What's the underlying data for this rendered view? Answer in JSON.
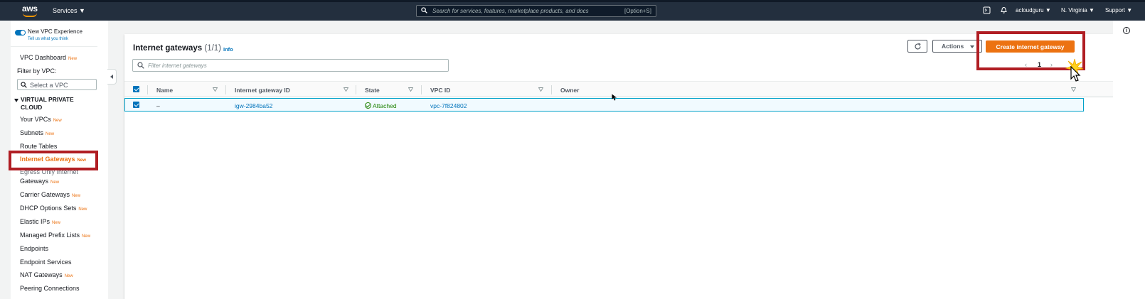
{
  "topnav": {
    "logo": "aws",
    "services_label": "Services",
    "search_placeholder": "Search for services, features, marketplace products, and docs",
    "search_shortcut": "[Option+S]",
    "account": "acloudguru",
    "region": "N. Virginia",
    "support": "Support"
  },
  "sidebar": {
    "new_experience": "New VPC Experience",
    "tell_us": "Tell us what you think",
    "dashboard": "VPC Dashboard",
    "new_badge": "New",
    "filter_label": "Filter by VPC:",
    "select_placeholder": "Select a VPC",
    "section_title": "VIRTUAL PRIVATE CLOUD",
    "items": [
      {
        "label": "Your VPCs",
        "new": "New"
      },
      {
        "label": "Subnets",
        "new": "New"
      },
      {
        "label": "Route Tables",
        "new": ""
      },
      {
        "label": "Internet Gateways",
        "new": "New"
      },
      {
        "label": "Egress Only Internet",
        "new": ""
      },
      {
        "label": "Gateways",
        "new": "New"
      },
      {
        "label": "Carrier Gateways",
        "new": "New"
      },
      {
        "label": "DHCP Options Sets",
        "new": "New"
      },
      {
        "label": "Elastic IPs",
        "new": "New"
      },
      {
        "label": "Managed Prefix Lists",
        "new": "New"
      },
      {
        "label": "Endpoints",
        "new": ""
      },
      {
        "label": "Endpoint Services",
        "new": ""
      },
      {
        "label": "NAT Gateways",
        "new": "New"
      },
      {
        "label": "Peering Connections",
        "new": ""
      }
    ]
  },
  "main": {
    "title": "Internet gateways",
    "count": "(1/1)",
    "info": "Info",
    "actions_label": "Actions",
    "create_label": "Create internet gateway",
    "filter_placeholder": "Filter internet gateways",
    "page_number": "1",
    "columns": [
      "Name",
      "Internet gateway ID",
      "State",
      "VPC ID",
      "Owner"
    ],
    "rows": [
      {
        "name": "–",
        "id": "igw-2984ba52",
        "state": "Attached",
        "vpc": "vpc-7f824802",
        "owner": ""
      }
    ]
  },
  "colors": {
    "nav_bg": "#232f3e",
    "accent_orange": "#ec7211",
    "link_blue": "#0073bb",
    "success_green": "#1d8102",
    "highlight_red": "#b01d23"
  }
}
